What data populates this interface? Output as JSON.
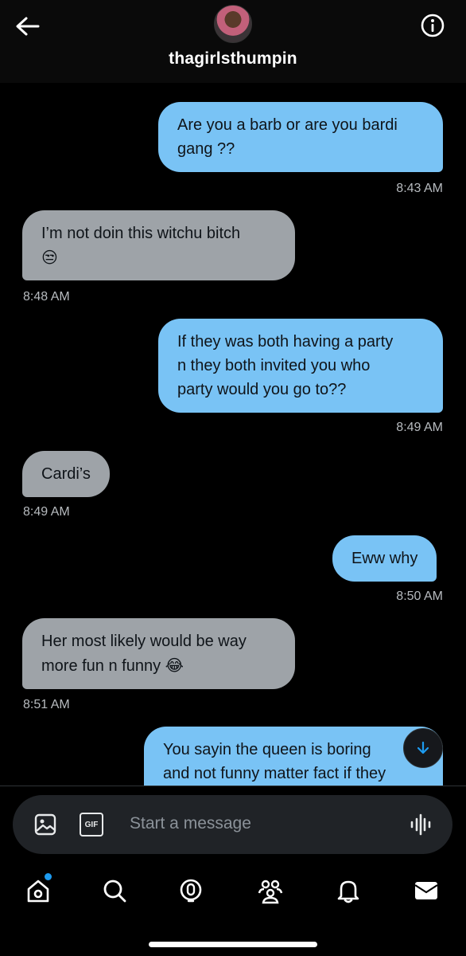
{
  "header": {
    "username": "thagirlsthumpin",
    "back_icon": "back-arrow-icon",
    "info_icon": "info-icon"
  },
  "messages": [
    {
      "direction": "sent",
      "lines": [
        "Are you a barb or are you bardi",
        "gang ??"
      ],
      "time": "8:43 AM"
    },
    {
      "direction": "received",
      "lines": [
        "I’m not doin this witchu bitch"
      ],
      "emoji": "😒",
      "time": "8:48 AM"
    },
    {
      "direction": "sent",
      "lines": [
        "If they was both having a party",
        "n they both invited  you who",
        "party would you go to??"
      ],
      "time": "8:49 AM"
    },
    {
      "direction": "received",
      "lines": [
        "Cardi’s"
      ],
      "time": "8:49 AM"
    },
    {
      "direction": "sent",
      "lines": [
        "Eww why"
      ],
      "time": "8:50 AM"
    },
    {
      "direction": "received",
      "lines": [
        "Her most likely would be way",
        "more fun n funny"
      ],
      "emoji": "😂",
      "time": "8:51 AM"
    },
    {
      "direction": "sent",
      "lines": [
        "You sayin the queen is boring",
        "and not funny matter fact if they"
      ]
    }
  ],
  "composer": {
    "placeholder": "Start a message",
    "image_icon": "image-icon",
    "gif_label": "GIF",
    "voice_icon": "voice-waveform-icon"
  },
  "tabbar": {
    "items": [
      "home-icon",
      "search-icon",
      "grok-icon",
      "communities-icon",
      "notifications-icon",
      "messages-icon"
    ],
    "home_has_notification_dot": true
  },
  "colors": {
    "sent_bubble": "#79c3f5",
    "received_bubble": "#9ea3a8",
    "accent": "#1d9bf0"
  }
}
